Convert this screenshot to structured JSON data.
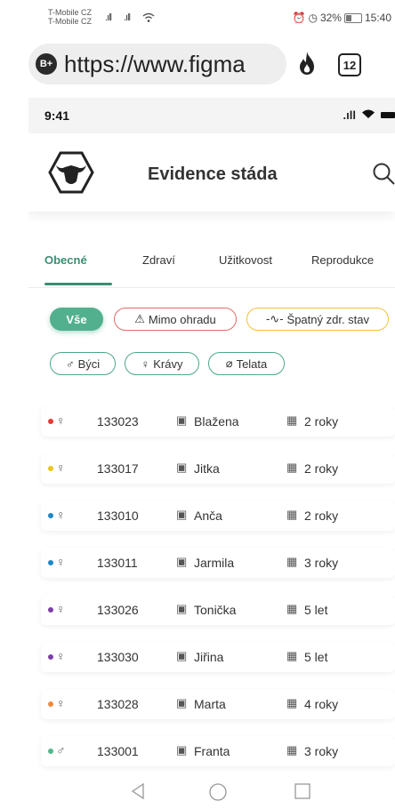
{
  "os_status": {
    "carrier1": "T-Mobile CZ",
    "carrier2": "T-Mobile CZ",
    "battery_pct": "32%",
    "time": "15:40"
  },
  "browser": {
    "url": "https://www.figma",
    "tab_count": "12",
    "menu_glyph": "⋮",
    "site_badge": "B+"
  },
  "ios_status": {
    "time": "9:41"
  },
  "header": {
    "title": "Evidence stáda"
  },
  "tabs": [
    {
      "label": "Obecné",
      "active": true
    },
    {
      "label": "Zdraví"
    },
    {
      "label": "Užitkovost"
    },
    {
      "label": "Reprodukce"
    }
  ],
  "filters": {
    "all": "Vše",
    "outside": "Mimo ohradu",
    "bad_health": "Špatný zdr. stav",
    "bulls": "Býci",
    "cows": "Krávy",
    "calves": "Telata"
  },
  "colors": {
    "accent": "#3a8e74",
    "chip_all": "#52b08e",
    "chip_outside": "#e46a6a",
    "chip_health": "#f0c23a",
    "chip_category": "#4fa886"
  },
  "animals": [
    {
      "id": "133023",
      "sex": "♀",
      "name": "Blažena",
      "age": "2 roky",
      "color": "#e53935"
    },
    {
      "id": "133017",
      "sex": "♀",
      "name": "Jitka",
      "age": "2 roky",
      "color": "#f0c419"
    },
    {
      "id": "133010",
      "sex": "♀",
      "name": "Anča",
      "age": "2 roky",
      "color": "#1e88c6"
    },
    {
      "id": "133011",
      "sex": "♀",
      "name": "Jarmila",
      "age": "3 roky",
      "color": "#1e88c6"
    },
    {
      "id": "133026",
      "sex": "♀",
      "name": "Tonička",
      "age": "5 let",
      "color": "#7b3fa6"
    },
    {
      "id": "133030",
      "sex": "♀",
      "name": "Jiřina",
      "age": "5 let",
      "color": "#7b3fa6"
    },
    {
      "id": "133028",
      "sex": "♀",
      "name": "Marta",
      "age": "4 roky",
      "color": "#f08a3a"
    },
    {
      "id": "133001",
      "sex": "♂",
      "name": "Franta",
      "age": "3 roky",
      "color": "#4fb88a"
    }
  ]
}
